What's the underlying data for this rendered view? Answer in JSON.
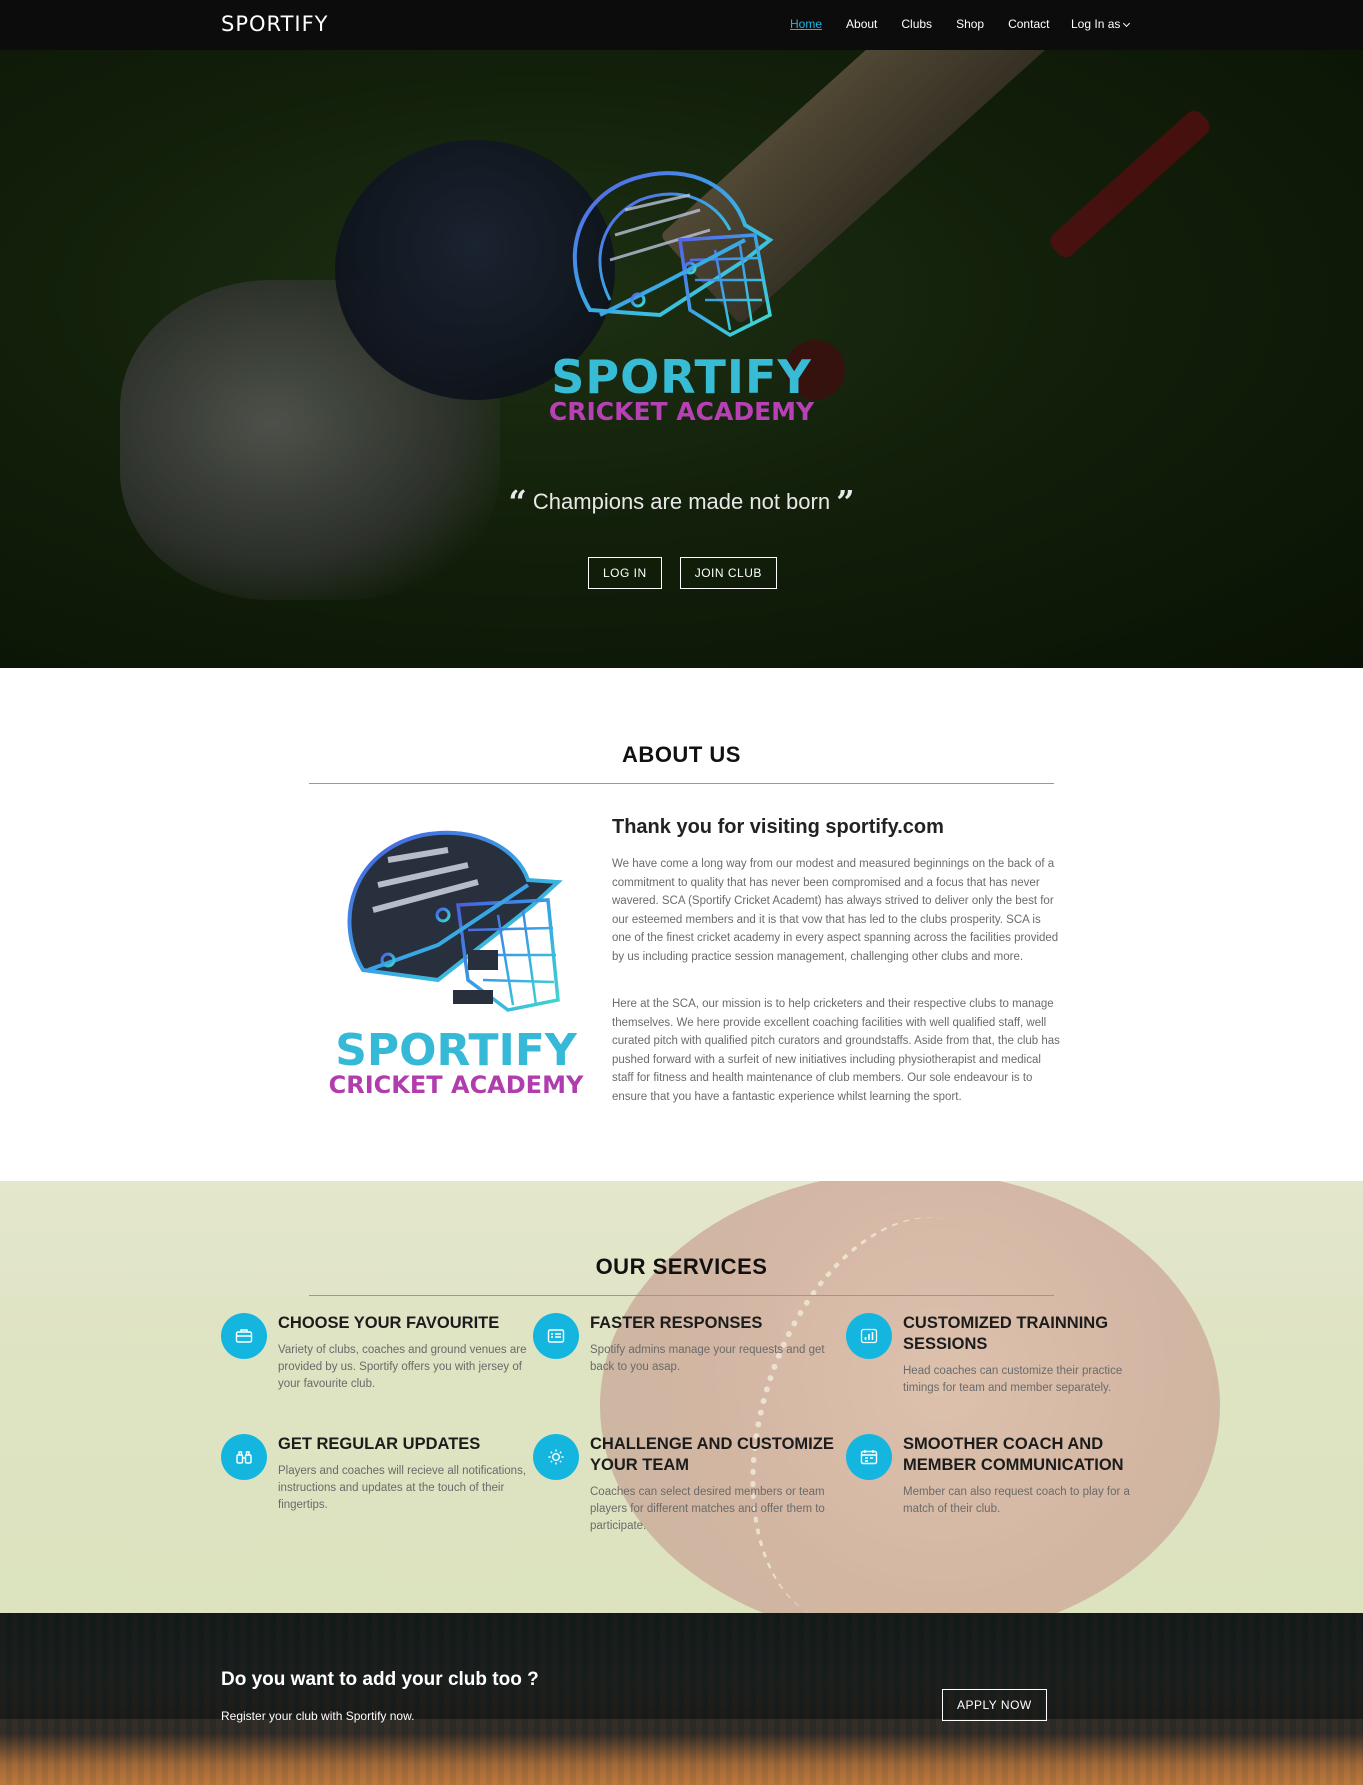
{
  "nav": {
    "brand": "SPORTIFY",
    "links": [
      "Home",
      "About",
      "Clubs",
      "Shop",
      "Contact"
    ],
    "login_as": "Log In as"
  },
  "hero": {
    "logo_brand": "SPORTIFY",
    "logo_sub": "CRICKET ACADEMY",
    "quote_open": "“",
    "quote": "Champions are made not born",
    "quote_close": "”",
    "login_button": "LOG IN",
    "join_button": "JOIN CLUB"
  },
  "about": {
    "title": "ABOUT US",
    "logo_brand": "SPORTIFY",
    "logo_sub": "CRICKET ACADEMY",
    "heading": "Thank you for visiting sportify.com",
    "paragraphs": [
      "We have come a long way from our modest and measured beginnings on the back of a commitment to quality that has never been compromised and a focus that has never wavered. SCA (Sportify Cricket Academt) has always strived to deliver only the best for our esteemed members and it is that vow that has led to the clubs prosperity. SCA is one of the finest cricket academy in every aspect spanning across the facilities provided by us including practice session management, challenging other clubs and more.",
      "Here at the SCA, our mission is to help cricketers and their respective clubs to manage themselves. We here provide excellent coaching facilities with well qualified staff, well curated pitch with qualified pitch curators and groundstaffs. Aside from that, the club has pushed forward with a surfeit of new initiatives including physiotherapist and medical staff for fitness and health maintenance of club members. Our sole endeavour is to ensure that you have a fantastic experience whilst learning the sport."
    ]
  },
  "services": {
    "title": "OUR SERVICES",
    "items": [
      {
        "icon": "briefcase-icon",
        "title": "CHOOSE YOUR FAVOURITE",
        "desc": "Variety of clubs, coaches and ground venues are provided by us. Sportify offers you with jersey of your favourite club."
      },
      {
        "icon": "card-icon",
        "title": "FASTER RESPONSES",
        "desc": "Spotify admins manage your requests and get back to you asap."
      },
      {
        "icon": "bar-chart-icon",
        "title": "CUSTOMIZED TRAINNING SESSIONS",
        "desc": "Head coaches can customize their practice timings for team and member separately."
      },
      {
        "icon": "binoculars-icon",
        "title": "GET REGULAR UPDATES",
        "desc": "Players and coaches will recieve all notifications, instructions and updates at the touch of their fingertips."
      },
      {
        "icon": "sun-icon",
        "title": "CHALLENGE AND CUSTOMIZE YOUR TEAM",
        "desc": "Coaches can select desired members or team players for different matches and offer them to participate."
      },
      {
        "icon": "calendar-icon",
        "title": "SMOOTHER COACH AND MEMBER COMMUNICATION",
        "desc": "Member can also request coach to play for a match of their club."
      }
    ]
  },
  "cta": {
    "title": "Do you want to add your club too ?",
    "subtitle": "Register your club with Sportify now.",
    "button": "APPLY NOW"
  },
  "colors": {
    "accent": "#14b6df",
    "brand_cyan": "#38bcd6",
    "brand_purple": "#b640b4"
  }
}
